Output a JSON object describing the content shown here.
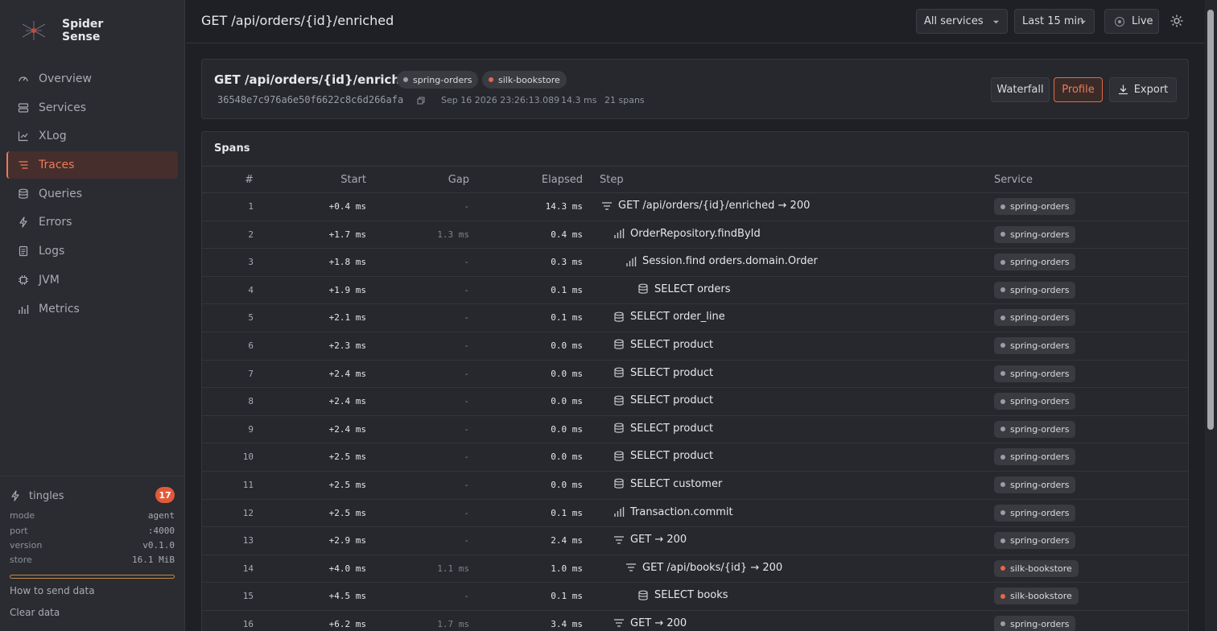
{
  "brand": {
    "name_line1": "Spider",
    "name_line2": "Sense"
  },
  "nav": [
    {
      "key": "overview",
      "label": "Overview",
      "icon": "gauge-icon",
      "active": false
    },
    {
      "key": "services",
      "label": "Services",
      "icon": "server-icon",
      "active": false
    },
    {
      "key": "xlog",
      "label": "XLog",
      "icon": "scatter-chart-icon",
      "active": false
    },
    {
      "key": "traces",
      "label": "Traces",
      "icon": "list-icon",
      "active": true
    },
    {
      "key": "queries",
      "label": "Queries",
      "icon": "database-icon",
      "active": false
    },
    {
      "key": "errors",
      "label": "Errors",
      "icon": "lightning-icon",
      "active": false
    },
    {
      "key": "logs",
      "label": "Logs",
      "icon": "document-icon",
      "active": false
    },
    {
      "key": "jvm",
      "label": "JVM",
      "icon": "chip-icon",
      "active": false
    },
    {
      "key": "metrics",
      "label": "Metrics",
      "icon": "bar-chart-icon",
      "active": false
    }
  ],
  "footer": {
    "tingles_label": "tingles",
    "tingles_count": "17",
    "meta": [
      {
        "k": "mode",
        "v": "agent"
      },
      {
        "k": "port",
        "v": ":4000"
      },
      {
        "k": "version",
        "v": "v0.1.0"
      },
      {
        "k": "store",
        "v": "16.1 MiB"
      }
    ],
    "how_to_send": "How to send data",
    "clear_data": "Clear data"
  },
  "topbar": {
    "title": "GET /api/orders/{id}/enriched",
    "services_select": "All services",
    "range_select": "Last 15 min",
    "live_label": "Live"
  },
  "trace": {
    "title": "GET /api/orders/{id}/enriched",
    "services": [
      {
        "name": "spring-orders",
        "color": "#9a9ea6"
      },
      {
        "name": "silk-bookstore",
        "color": "#e8664a"
      }
    ],
    "trace_id": "36548e7c976a6e50f6622c8c6d266afa",
    "timestamp": "Sep 16 2026 23:26:13.089",
    "duration": "14.3 ms",
    "span_count": "21 spans",
    "buttons": {
      "waterfall": "Waterfall",
      "profile": "Profile",
      "export": "Export"
    }
  },
  "spans": {
    "title": "Spans",
    "headers": {
      "num": "#",
      "start": "Start",
      "gap": "Gap",
      "elapsed": "Elapsed",
      "step": "Step",
      "service": "Service"
    },
    "rows": [
      {
        "num": "1",
        "start": "+0.4 ms",
        "gap": "-",
        "elapsed": "14.3 ms",
        "depth": 0,
        "icon": "http",
        "step": "GET /api/orders/{id}/enriched → 200",
        "service": "spring-orders",
        "svc_color": "#9a9ea6"
      },
      {
        "num": "2",
        "start": "+1.7 ms",
        "gap": "1.3 ms",
        "elapsed": "0.4 ms",
        "depth": 1,
        "icon": "method",
        "step": "OrderRepository.findById",
        "service": "spring-orders",
        "svc_color": "#9a9ea6"
      },
      {
        "num": "3",
        "start": "+1.8 ms",
        "gap": "-",
        "elapsed": "0.3 ms",
        "depth": 2,
        "icon": "method",
        "step": "Session.find orders.domain.Order",
        "service": "spring-orders",
        "svc_color": "#9a9ea6"
      },
      {
        "num": "4",
        "start": "+1.9 ms",
        "gap": "-",
        "elapsed": "0.1 ms",
        "depth": 3,
        "icon": "db",
        "step": "SELECT orders",
        "service": "spring-orders",
        "svc_color": "#9a9ea6"
      },
      {
        "num": "5",
        "start": "+2.1 ms",
        "gap": "-",
        "elapsed": "0.1 ms",
        "depth": 1,
        "icon": "db",
        "step": "SELECT order_line",
        "service": "spring-orders",
        "svc_color": "#9a9ea6"
      },
      {
        "num": "6",
        "start": "+2.3 ms",
        "gap": "-",
        "elapsed": "0.0 ms",
        "depth": 1,
        "icon": "db",
        "step": "SELECT product",
        "service": "spring-orders",
        "svc_color": "#9a9ea6"
      },
      {
        "num": "7",
        "start": "+2.4 ms",
        "gap": "-",
        "elapsed": "0.0 ms",
        "depth": 1,
        "icon": "db",
        "step": "SELECT product",
        "service": "spring-orders",
        "svc_color": "#9a9ea6"
      },
      {
        "num": "8",
        "start": "+2.4 ms",
        "gap": "-",
        "elapsed": "0.0 ms",
        "depth": 1,
        "icon": "db",
        "step": "SELECT product",
        "service": "spring-orders",
        "svc_color": "#9a9ea6"
      },
      {
        "num": "9",
        "start": "+2.4 ms",
        "gap": "-",
        "elapsed": "0.0 ms",
        "depth": 1,
        "icon": "db",
        "step": "SELECT product",
        "service": "spring-orders",
        "svc_color": "#9a9ea6"
      },
      {
        "num": "10",
        "start": "+2.5 ms",
        "gap": "-",
        "elapsed": "0.0 ms",
        "depth": 1,
        "icon": "db",
        "step": "SELECT product",
        "service": "spring-orders",
        "svc_color": "#9a9ea6"
      },
      {
        "num": "11",
        "start": "+2.5 ms",
        "gap": "-",
        "elapsed": "0.0 ms",
        "depth": 1,
        "icon": "db",
        "step": "SELECT customer",
        "service": "spring-orders",
        "svc_color": "#9a9ea6"
      },
      {
        "num": "12",
        "start": "+2.5 ms",
        "gap": "-",
        "elapsed": "0.1 ms",
        "depth": 1,
        "icon": "method",
        "step": "Transaction.commit",
        "service": "spring-orders",
        "svc_color": "#9a9ea6"
      },
      {
        "num": "13",
        "start": "+2.9 ms",
        "gap": "-",
        "elapsed": "2.4 ms",
        "depth": 1,
        "icon": "http",
        "step": "GET → 200",
        "service": "spring-orders",
        "svc_color": "#9a9ea6"
      },
      {
        "num": "14",
        "start": "+4.0 ms",
        "gap": "1.1 ms",
        "elapsed": "1.0 ms",
        "depth": 2,
        "icon": "http",
        "step": "GET /api/books/{id} → 200",
        "service": "silk-bookstore",
        "svc_color": "#e8664a"
      },
      {
        "num": "15",
        "start": "+4.5 ms",
        "gap": "-",
        "elapsed": "0.1 ms",
        "depth": 3,
        "icon": "db",
        "step": "SELECT books",
        "service": "silk-bookstore",
        "svc_color": "#e8664a"
      },
      {
        "num": "16",
        "start": "+6.2 ms",
        "gap": "1.7 ms",
        "elapsed": "3.4 ms",
        "depth": 1,
        "icon": "http",
        "step": "GET → 200",
        "service": "spring-orders",
        "svc_color": "#9a9ea6"
      }
    ]
  },
  "colors": {
    "accent": "#ee7a58",
    "background": "#1f2025",
    "sidebar": "#2a2c31"
  }
}
